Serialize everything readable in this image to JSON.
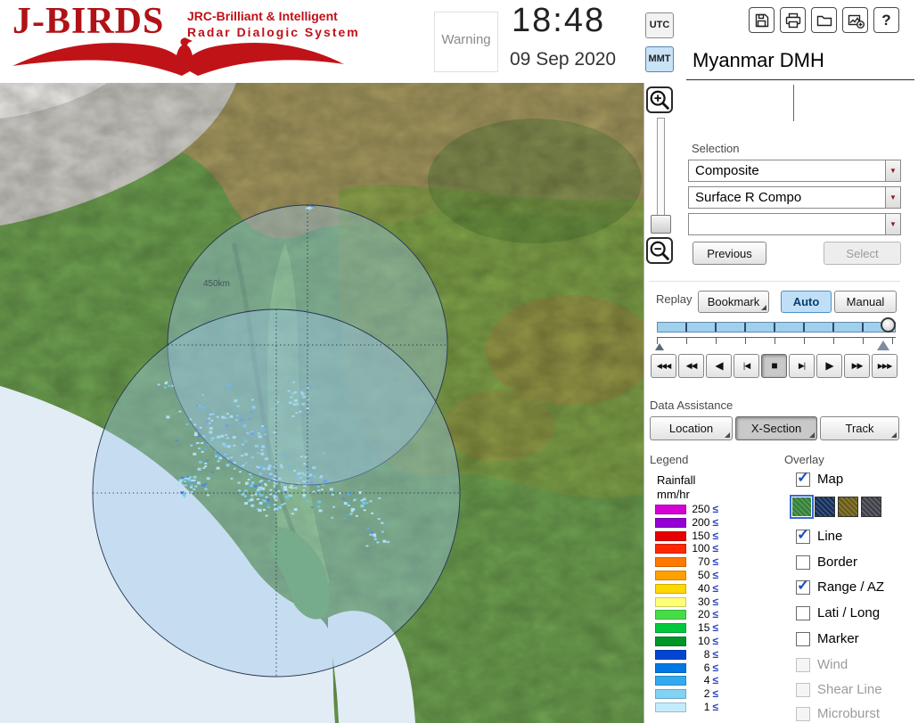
{
  "colors": {
    "brand_red": "#c01018",
    "highlight_blue": "#bfdff7",
    "check_blue": "#1b50bb"
  },
  "header": {
    "logo": {
      "title": "J-BIRDS",
      "tagline1": "JRC-Brilliant & Intelligent",
      "tagline2": "Radar Dialogic System"
    },
    "warning_label": "Warning",
    "clock": {
      "time": "18:48",
      "date": "09 Sep 2020"
    },
    "timezone": {
      "utc": "UTC",
      "mmt": "MMT",
      "selected": "MMT"
    },
    "toolbar": {
      "help_glyph": "?",
      "icons": [
        "save",
        "print",
        "open",
        "export",
        "help"
      ]
    },
    "station_title": "Myanmar DMH"
  },
  "map": {
    "range_label": "450km"
  },
  "selection": {
    "label": "Selection",
    "combos": [
      "Composite",
      "Surface R Compo",
      ""
    ],
    "previous_label": "Previous",
    "select_label": "Select"
  },
  "replay": {
    "label": "Replay",
    "bookmark_label": "Bookmark",
    "auto_label": "Auto",
    "manual_label": "Manual",
    "mode": "Auto",
    "playback": [
      "◀◀◀",
      "◀◀",
      "◀",
      "|◀",
      "■",
      "▶|",
      "▶",
      "▶▶",
      "▶▶▶"
    ],
    "active_symbol": "■"
  },
  "data_assistance": {
    "label": "Data Assistance",
    "buttons": [
      "Location",
      "X-Section",
      "Track"
    ],
    "active": "X-Section"
  },
  "legend": {
    "label": "Legend",
    "title_line1": "Rainfall",
    "title_line2": "mm/hr",
    "operator": "≤",
    "rows": [
      {
        "value": "250",
        "color": "#d400d4"
      },
      {
        "value": "200",
        "color": "#9400d3"
      },
      {
        "value": "150",
        "color": "#e60000"
      },
      {
        "value": "100",
        "color": "#ff2800"
      },
      {
        "value": "70",
        "color": "#ff7800"
      },
      {
        "value": "50",
        "color": "#ffa000"
      },
      {
        "value": "40",
        "color": "#ffd800"
      },
      {
        "value": "30",
        "color": "#ffff78"
      },
      {
        "value": "20",
        "color": "#46dc46"
      },
      {
        "value": "15",
        "color": "#00c83c"
      },
      {
        "value": "10",
        "color": "#009628"
      },
      {
        "value": "8",
        "color": "#0046d2"
      },
      {
        "value": "6",
        "color": "#0078e6"
      },
      {
        "value": "4",
        "color": "#32aaf0"
      },
      {
        "value": "2",
        "color": "#82d2f5"
      },
      {
        "value": "1",
        "color": "#c3ecfa"
      }
    ]
  },
  "overlay": {
    "label": "Overlay",
    "check_glyph": "✓",
    "items": [
      {
        "label": "Map",
        "checked": true,
        "enabled": true
      },
      {
        "label": "Line",
        "checked": true,
        "enabled": true
      },
      {
        "label": "Border",
        "checked": false,
        "enabled": true
      },
      {
        "label": "Range / AZ",
        "checked": true,
        "enabled": true
      },
      {
        "label": "Lati / Long",
        "checked": false,
        "enabled": true
      },
      {
        "label": "Marker",
        "checked": false,
        "enabled": true
      },
      {
        "label": "Wind",
        "checked": false,
        "enabled": false
      },
      {
        "label": "Shear Line",
        "checked": false,
        "enabled": false
      },
      {
        "label": "Microburst",
        "checked": false,
        "enabled": false
      }
    ],
    "map_styles": [
      {
        "name": "green-terrain",
        "color": "#35823a",
        "selected": true
      },
      {
        "name": "navy-terrain",
        "color": "#16315c",
        "selected": false
      },
      {
        "name": "olive-terrain",
        "color": "#6a5c16",
        "selected": false
      },
      {
        "name": "gray-terrain",
        "color": "#40414a",
        "selected": false
      }
    ]
  }
}
